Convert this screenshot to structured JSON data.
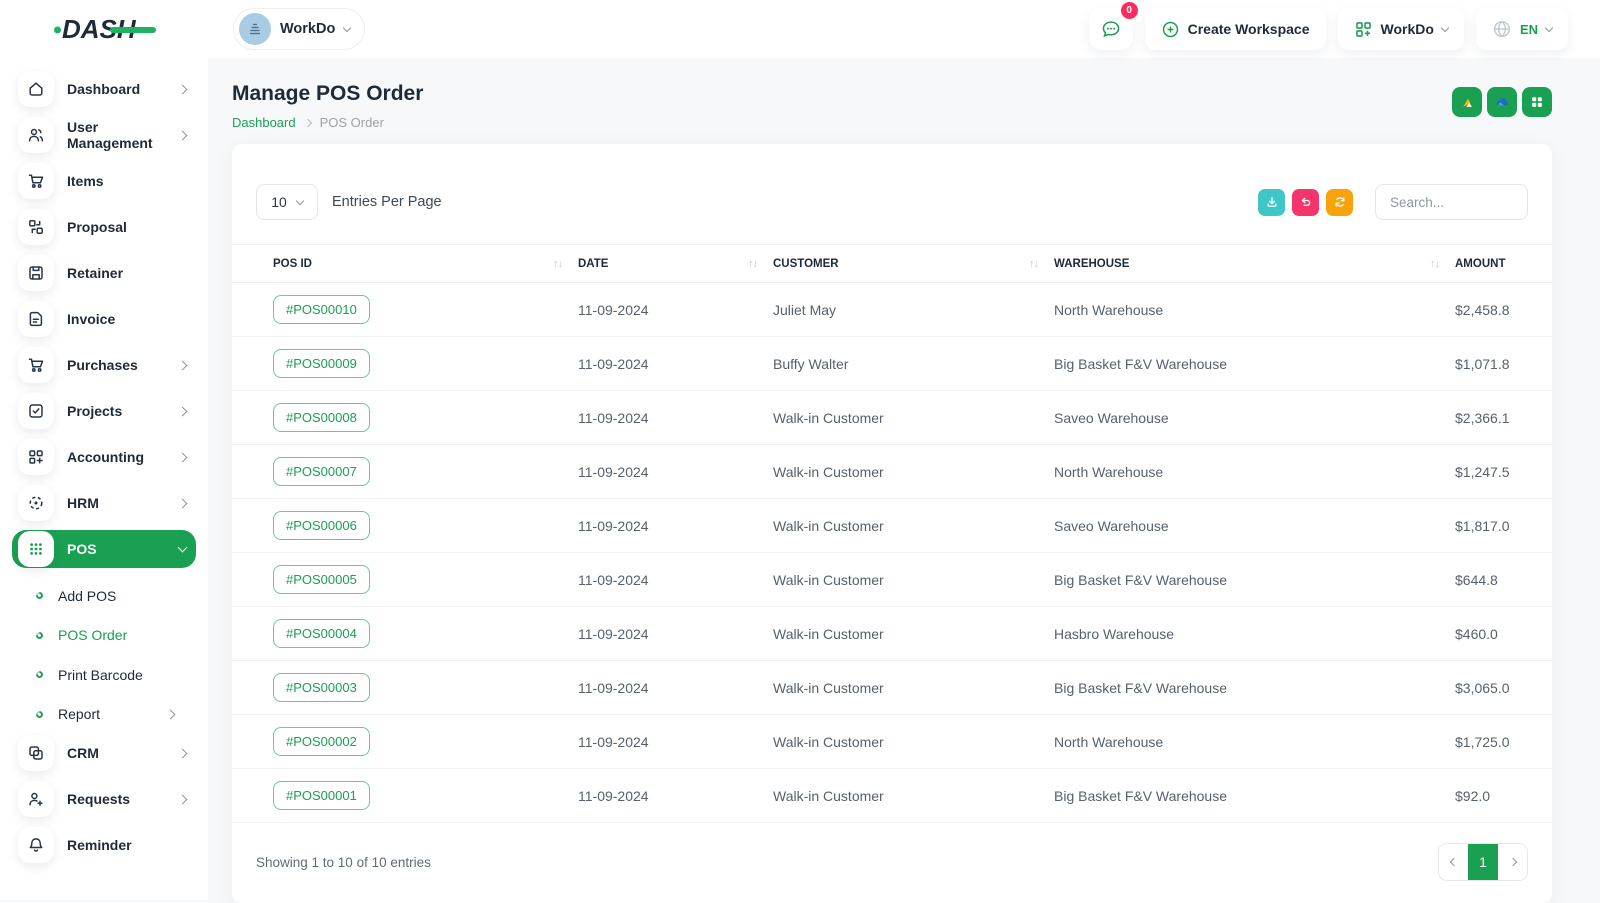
{
  "brand": {
    "name": "DASH"
  },
  "topbar": {
    "workspace_switcher_label": "WorkDo",
    "messages_count": "0",
    "create_workspace_label": "Create Workspace",
    "company_menu_label": "WorkDo",
    "language_label": "EN"
  },
  "sidebar": {
    "items": [
      {
        "label": "Dashboard"
      },
      {
        "label": "User Management"
      },
      {
        "label": "Items"
      },
      {
        "label": "Proposal"
      },
      {
        "label": "Retainer"
      },
      {
        "label": "Invoice"
      },
      {
        "label": "Purchases"
      },
      {
        "label": "Projects"
      },
      {
        "label": "Accounting"
      },
      {
        "label": "HRM"
      },
      {
        "label": "POS"
      },
      {
        "label": "CRM"
      },
      {
        "label": "Requests"
      },
      {
        "label": "Reminder"
      }
    ],
    "pos_submenu": [
      {
        "label": "Add POS"
      },
      {
        "label": "POS Order"
      },
      {
        "label": "Print Barcode"
      },
      {
        "label": "Report"
      }
    ]
  },
  "page": {
    "title": "Manage POS Order",
    "breadcrumb_home": "Dashboard",
    "breadcrumb_current": "POS Order"
  },
  "toolbar": {
    "entries_per_page_value": "10",
    "entries_per_page_label": "Entries Per Page",
    "search_placeholder": "Search..."
  },
  "table": {
    "headers": [
      "POS ID",
      "DATE",
      "CUSTOMER",
      "WAREHOUSE",
      "AMOUNT"
    ],
    "rows": [
      {
        "id": "#POS00010",
        "date": "11-09-2024",
        "customer": "Juliet May",
        "warehouse": "North Warehouse",
        "amount": "$2,458.8"
      },
      {
        "id": "#POS00009",
        "date": "11-09-2024",
        "customer": "Buffy Walter",
        "warehouse": "Big Basket F&V Warehouse",
        "amount": "$1,071.8"
      },
      {
        "id": "#POS00008",
        "date": "11-09-2024",
        "customer": "Walk-in Customer",
        "warehouse": "Saveo Warehouse",
        "amount": "$2,366.1"
      },
      {
        "id": "#POS00007",
        "date": "11-09-2024",
        "customer": "Walk-in Customer",
        "warehouse": "North Warehouse",
        "amount": "$1,247.5"
      },
      {
        "id": "#POS00006",
        "date": "11-09-2024",
        "customer": "Walk-in Customer",
        "warehouse": "Saveo Warehouse",
        "amount": "$1,817.0"
      },
      {
        "id": "#POS00005",
        "date": "11-09-2024",
        "customer": "Walk-in Customer",
        "warehouse": "Big Basket F&V Warehouse",
        "amount": "$644.8"
      },
      {
        "id": "#POS00004",
        "date": "11-09-2024",
        "customer": "Walk-in Customer",
        "warehouse": "Hasbro Warehouse",
        "amount": "$460.0"
      },
      {
        "id": "#POS00003",
        "date": "11-09-2024",
        "customer": "Walk-in Customer",
        "warehouse": "Big Basket F&V Warehouse",
        "amount": "$3,065.0"
      },
      {
        "id": "#POS00002",
        "date": "11-09-2024",
        "customer": "Walk-in Customer",
        "warehouse": "North Warehouse",
        "amount": "$1,725.0"
      },
      {
        "id": "#POS00001",
        "date": "11-09-2024",
        "customer": "Walk-in Customer",
        "warehouse": "Big Basket F&V Warehouse",
        "amount": "$92.0"
      }
    ]
  },
  "footer": {
    "showing_text": "Showing 1 to 10 of 10 entries",
    "current_page": "1"
  },
  "colors": {
    "primary_green": "#1aa053",
    "teal": "#3fc6c6",
    "pink": "#f4356c",
    "orange": "#f7a40c",
    "badge_red": "#fa2c5d"
  }
}
